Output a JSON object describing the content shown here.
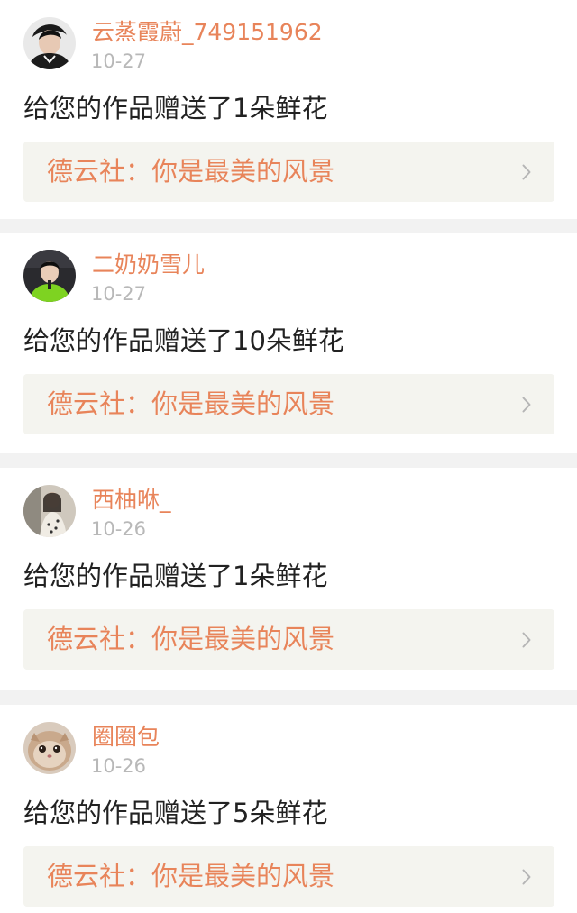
{
  "notifications": [
    {
      "username": "云蒸霞蔚_749151962",
      "date": "10-27",
      "message": "给您的作品赠送了1朵鲜花",
      "work_title": "德云社：你是最美的风景",
      "avatar": "avatar-icon"
    },
    {
      "username": "二奶奶雪儿",
      "date": "10-27",
      "message": "给您的作品赠送了10朵鲜花",
      "work_title": "德云社：你是最美的风景",
      "avatar": "avatar-icon"
    },
    {
      "username": "西柚咻_",
      "date": "10-26",
      "message": "给您的作品赠送了1朵鲜花",
      "work_title": "德云社：你是最美的风景",
      "avatar": "avatar-icon"
    },
    {
      "username": "圈圈包",
      "date": "10-26",
      "message": "给您的作品赠送了5朵鲜花",
      "work_title": "德云社：你是最美的风景",
      "avatar": "avatar-icon"
    }
  ],
  "colors": {
    "accent": "#e8845a",
    "date": "#b8b8b8",
    "text": "#222222",
    "link_bg": "#f4f4ef",
    "divider": "#f2f2f2"
  },
  "icons": {
    "chevron": "chevron-right-icon"
  }
}
